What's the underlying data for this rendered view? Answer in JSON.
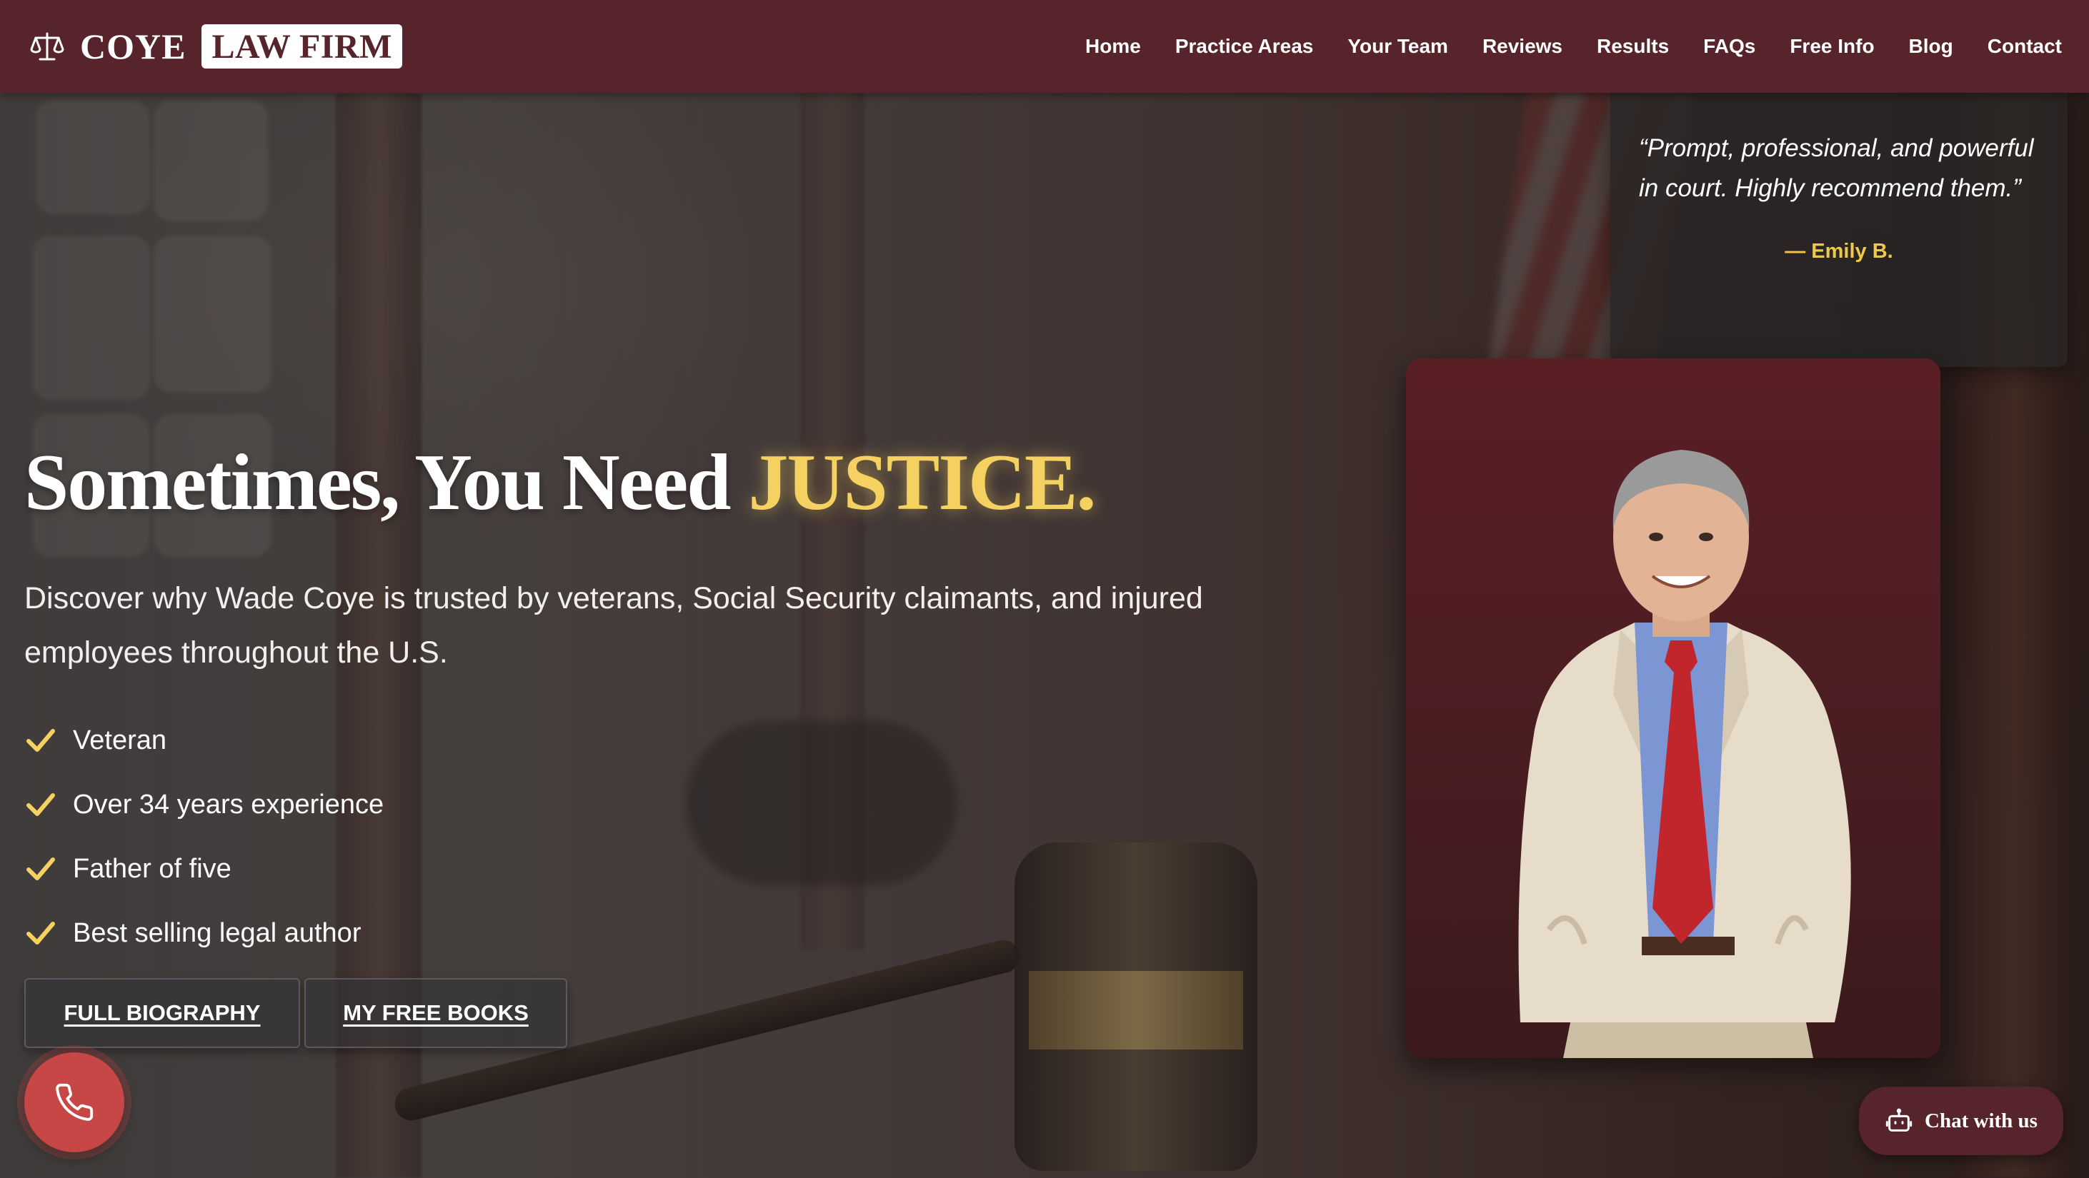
{
  "header": {
    "logo_name": "COYE",
    "logo_box": "LAW FIRM",
    "nav": [
      "Home",
      "Practice Areas",
      "Your Team",
      "Reviews",
      "Results",
      "FAQs",
      "Free Info",
      "Blog",
      "Contact"
    ]
  },
  "hero": {
    "headline_main": "Sometimes, You Need",
    "headline_accent": "JUSTICE.",
    "subtext": "Discover why Wade Coye is trusted by veterans, Social Security claimants, and injured employees throughout the U.S.",
    "features": [
      "Veteran",
      "Over 34 years experience",
      "Father of five",
      "Best selling legal author"
    ],
    "buttons": {
      "biography": "FULL BIOGRAPHY",
      "books": "MY FREE BOOKS"
    }
  },
  "testimonial": {
    "quote": "“Prompt, professional, and powerful in court. Highly recommend them.”",
    "author": "— Emily B."
  },
  "floating": {
    "chat_label": "Chat with us"
  },
  "icons": {
    "logo": "scales-icon",
    "feature_bullet": "check-icon",
    "call": "phone-icon",
    "chat": "robot-icon"
  },
  "colors": {
    "brand": "#56242a",
    "accent": "#f4d160",
    "call_button": "#c74646"
  }
}
